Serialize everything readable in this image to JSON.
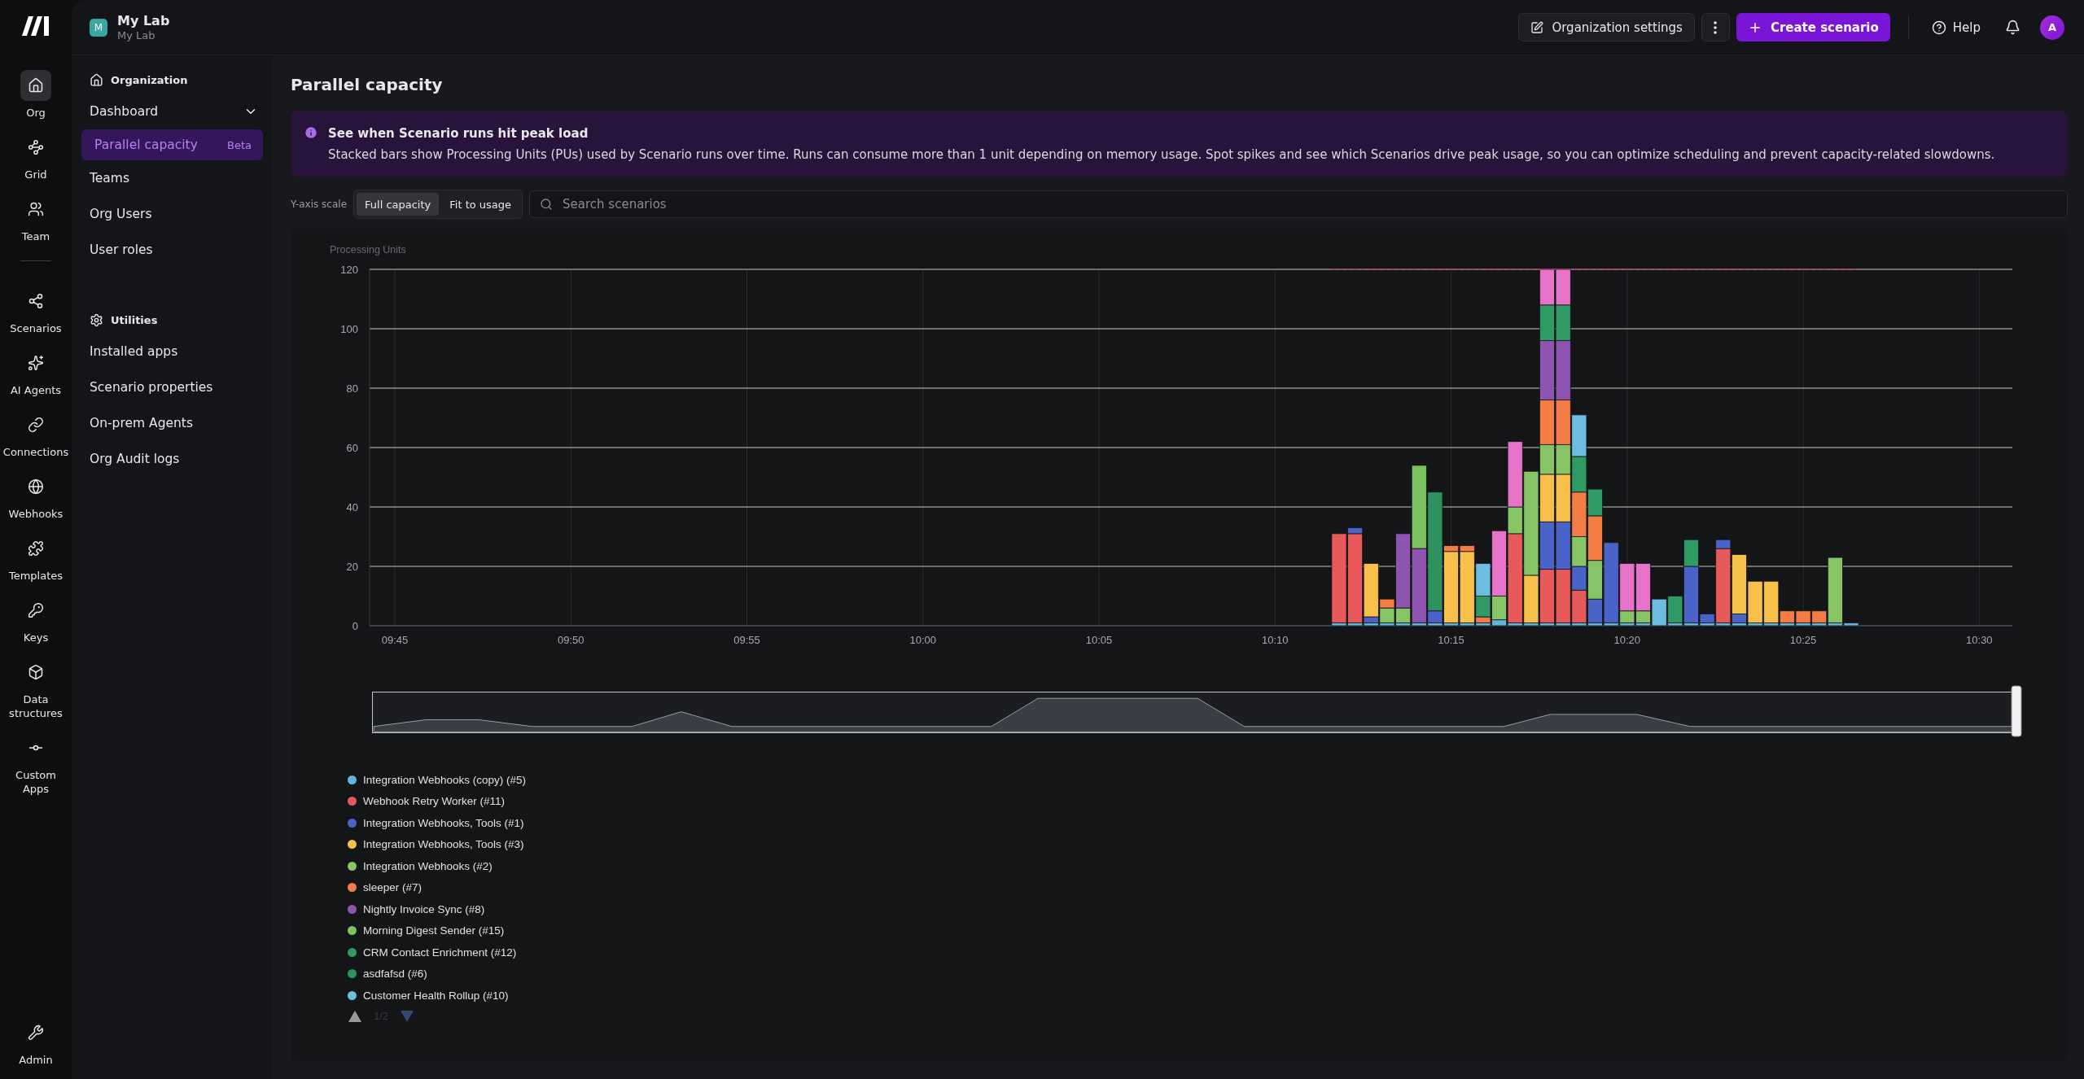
{
  "rail": {
    "top_items": [
      {
        "label": "Org",
        "selected": true
      },
      {
        "label": "Grid",
        "selected": false
      },
      {
        "label": "Team",
        "selected": false
      }
    ],
    "main_items": [
      {
        "label": "Scenarios",
        "selected": false
      },
      {
        "label": "AI Agents",
        "selected": false
      },
      {
        "label": "Connections",
        "selected": false
      },
      {
        "label": "Webhooks",
        "selected": false
      },
      {
        "label": "Templates",
        "selected": false
      },
      {
        "label": "Keys",
        "selected": false
      },
      {
        "label": "Data structures",
        "selected": false
      },
      {
        "label": "Custom Apps",
        "selected": false
      }
    ],
    "bottom_items": [
      {
        "label": "Admin",
        "selected": false
      }
    ]
  },
  "workspace": {
    "avatar": "M",
    "name": "My Lab",
    "subtitle": "My Lab"
  },
  "header": {
    "settings_button": "Organization settings",
    "create_button": "Create scenario",
    "help": "Help",
    "user_avatar": "A"
  },
  "sidebar": {
    "sections": [
      {
        "title": "Organization",
        "items": [
          {
            "label": "Dashboard",
            "selected": false,
            "expanded": true,
            "children": [
              {
                "label": "Parallel capacity",
                "badge": "Beta",
                "selected": true
              }
            ]
          },
          {
            "label": "Teams",
            "selected": false
          },
          {
            "label": "Org Users",
            "selected": false
          },
          {
            "label": "User roles",
            "selected": false
          }
        ]
      },
      {
        "title": "Utilities",
        "items": [
          {
            "label": "Installed apps",
            "selected": false
          },
          {
            "label": "Scenario properties",
            "selected": false
          },
          {
            "label": "On-prem Agents",
            "selected": false
          },
          {
            "label": "Org Audit logs",
            "selected": false
          }
        ]
      }
    ]
  },
  "page_title": "Parallel capacity",
  "banner": {
    "title": "See when Scenario runs hit peak load",
    "text": "Stacked bars show Processing Units (PUs) used by Scenario runs over time. Runs can consume more than 1 unit depending on memory usage. Spot spikes and see which Scenarios drive peak usage, so you can optimize scheduling and prevent capacity-related slowdowns."
  },
  "controls": {
    "scale_label": "Y-axis scale",
    "scale_options": [
      {
        "label": "Full capacity",
        "selected": true
      },
      {
        "label": "Fit to usage",
        "selected": false
      }
    ],
    "search": {
      "placeholder": "Search scenarios"
    }
  },
  "chart": {
    "chart_data": {
      "type": "bar",
      "stacked": true,
      "grid": true,
      "ylabel": "Processing Units",
      "ylim": [
        0,
        120
      ],
      "yticks": [
        0,
        20,
        40,
        60,
        80,
        100,
        120
      ],
      "categories": [
        "09:45",
        null,
        null,
        null,
        null,
        null,
        null,
        null,
        null,
        null,
        null,
        "09:50",
        null,
        null,
        null,
        null,
        null,
        null,
        null,
        null,
        null,
        null,
        "09:55",
        null,
        null,
        null,
        null,
        null,
        null,
        null,
        null,
        null,
        null,
        "10:00",
        null,
        null,
        null,
        null,
        null,
        null,
        null,
        null,
        null,
        null,
        "10:05",
        null,
        null,
        null,
        null,
        null,
        null,
        null,
        null,
        null,
        null,
        "10:10",
        null,
        null,
        null,
        null,
        null,
        null,
        null,
        null,
        null,
        null,
        "10:15",
        null,
        null,
        null,
        null,
        null,
        null,
        null,
        null,
        null,
        null,
        "10:20",
        null,
        null,
        null,
        null,
        null,
        null,
        null,
        null,
        null,
        null,
        "10:25",
        null,
        null,
        null,
        null,
        null,
        null,
        null,
        null,
        null,
        null,
        "10:30"
      ],
      "series": [
        {
          "name": "Integration Webhooks (copy) (#5)",
          "color": "#62b5db",
          "values": [
            0,
            0,
            0,
            0,
            0,
            0,
            0,
            0,
            0,
            0,
            0,
            0,
            0,
            0,
            0,
            0,
            0,
            0,
            0,
            0,
            0,
            0,
            0,
            0,
            0,
            0,
            0,
            0,
            0,
            0,
            0,
            0,
            0,
            0,
            0,
            0,
            0,
            0,
            0,
            0,
            0,
            0,
            0,
            0,
            0,
            0,
            0,
            0,
            0,
            0,
            0,
            0,
            0,
            0,
            0,
            0,
            0,
            0,
            0,
            1,
            1,
            1,
            1,
            1,
            1,
            1,
            1,
            1,
            1,
            2,
            1,
            1,
            1,
            1,
            1,
            1,
            1,
            1,
            1,
            0,
            1,
            1,
            1,
            1,
            1,
            1,
            1,
            1,
            1,
            1,
            1,
            1,
            0,
            0,
            0,
            0,
            0,
            0,
            0,
            0
          ]
        },
        {
          "name": "Webhook Retry Worker (#11)",
          "color": "#e85a5a",
          "values": [
            0,
            0,
            0,
            0,
            0,
            0,
            0,
            0,
            0,
            0,
            0,
            0,
            0,
            0,
            0,
            0,
            0,
            0,
            0,
            0,
            0,
            0,
            0,
            0,
            0,
            0,
            0,
            0,
            0,
            0,
            0,
            0,
            0,
            0,
            0,
            0,
            0,
            0,
            0,
            0,
            0,
            0,
            0,
            0,
            0,
            0,
            0,
            0,
            0,
            0,
            0,
            0,
            0,
            0,
            0,
            0,
            0,
            0,
            0,
            30,
            30,
            0,
            0,
            0,
            0,
            0,
            0,
            0,
            0,
            0,
            30,
            0,
            18,
            18,
            11,
            0,
            0,
            0,
            0,
            0,
            0,
            0,
            0,
            25,
            0,
            0,
            0,
            0,
            0,
            0,
            0,
            0,
            0,
            0,
            0,
            0,
            0,
            0,
            0,
            0
          ]
        },
        {
          "name": "Integration Webhooks, Tools (#1)",
          "color": "#4a63c9",
          "values": [
            0,
            0,
            0,
            0,
            0,
            0,
            0,
            0,
            0,
            0,
            0,
            0,
            0,
            0,
            0,
            0,
            0,
            0,
            0,
            0,
            0,
            0,
            0,
            0,
            0,
            0,
            0,
            0,
            0,
            0,
            0,
            0,
            0,
            0,
            0,
            0,
            0,
            0,
            0,
            0,
            0,
            0,
            0,
            0,
            0,
            0,
            0,
            0,
            0,
            0,
            0,
            0,
            0,
            0,
            0,
            0,
            0,
            0,
            0,
            0,
            2,
            2,
            0,
            0,
            0,
            4,
            0,
            0,
            0,
            0,
            0,
            0,
            16,
            16,
            8,
            8,
            27,
            0,
            0,
            0,
            0,
            19,
            3,
            3,
            3,
            0,
            0,
            0,
            0,
            0,
            0,
            0,
            0,
            0,
            0,
            0,
            0,
            0,
            0,
            0
          ]
        },
        {
          "name": "Integration Webhooks, Tools (#3)",
          "color": "#f7c04a",
          "values": [
            0,
            0,
            0,
            0,
            0,
            0,
            0,
            0,
            0,
            0,
            0,
            0,
            0,
            0,
            0,
            0,
            0,
            0,
            0,
            0,
            0,
            0,
            0,
            0,
            0,
            0,
            0,
            0,
            0,
            0,
            0,
            0,
            0,
            0,
            0,
            0,
            0,
            0,
            0,
            0,
            0,
            0,
            0,
            0,
            0,
            0,
            0,
            0,
            0,
            0,
            0,
            0,
            0,
            0,
            0,
            0,
            0,
            0,
            0,
            0,
            0,
            18,
            0,
            0,
            0,
            0,
            24,
            24,
            0,
            0,
            0,
            16,
            16,
            16,
            0,
            0,
            0,
            0,
            0,
            0,
            0,
            0,
            0,
            0,
            20,
            14,
            14,
            0,
            0,
            0,
            0,
            0,
            0,
            0,
            0,
            0,
            0,
            0,
            0,
            0
          ]
        },
        {
          "name": "Integration Webhooks (#2)",
          "color": "#86c466",
          "values": [
            0,
            0,
            0,
            0,
            0,
            0,
            0,
            0,
            0,
            0,
            0,
            0,
            0,
            0,
            0,
            0,
            0,
            0,
            0,
            0,
            0,
            0,
            0,
            0,
            0,
            0,
            0,
            0,
            0,
            0,
            0,
            0,
            0,
            0,
            0,
            0,
            0,
            0,
            0,
            0,
            0,
            0,
            0,
            0,
            0,
            0,
            0,
            0,
            0,
            0,
            0,
            0,
            0,
            0,
            0,
            0,
            0,
            0,
            0,
            0,
            0,
            0,
            5,
            5,
            0,
            0,
            0,
            0,
            0,
            8,
            9,
            35,
            10,
            10,
            10,
            13,
            0,
            4,
            4,
            0,
            0,
            0,
            0,
            0,
            0,
            0,
            0,
            0,
            0,
            0,
            22,
            0,
            0,
            0,
            0,
            0,
            0,
            0,
            0,
            0
          ]
        },
        {
          "name": "sleeper (#7)",
          "color": "#f47c45",
          "values": [
            0,
            0,
            0,
            0,
            0,
            0,
            0,
            0,
            0,
            0,
            0,
            0,
            0,
            0,
            0,
            0,
            0,
            0,
            0,
            0,
            0,
            0,
            0,
            0,
            0,
            0,
            0,
            0,
            0,
            0,
            0,
            0,
            0,
            0,
            0,
            0,
            0,
            0,
            0,
            0,
            0,
            0,
            0,
            0,
            0,
            0,
            0,
            0,
            0,
            0,
            0,
            0,
            0,
            0,
            0,
            0,
            0,
            0,
            0,
            0,
            0,
            0,
            3,
            0,
            0,
            0,
            2,
            2,
            2,
            0,
            0,
            0,
            15,
            15,
            15,
            15,
            0,
            0,
            0,
            0,
            0,
            0,
            0,
            0,
            0,
            0,
            0,
            4,
            4,
            4,
            0,
            0,
            0,
            0,
            0,
            0,
            0,
            0,
            0,
            0
          ]
        },
        {
          "name": "Nightly Invoice Sync (#8)",
          "color": "#8e55b0",
          "values": [
            0,
            0,
            0,
            0,
            0,
            0,
            0,
            0,
            0,
            0,
            0,
            0,
            0,
            0,
            0,
            0,
            0,
            0,
            0,
            0,
            0,
            0,
            0,
            0,
            0,
            0,
            0,
            0,
            0,
            0,
            0,
            0,
            0,
            0,
            0,
            0,
            0,
            0,
            0,
            0,
            0,
            0,
            0,
            0,
            0,
            0,
            0,
            0,
            0,
            0,
            0,
            0,
            0,
            0,
            0,
            0,
            0,
            0,
            0,
            0,
            0,
            0,
            0,
            25,
            25,
            0,
            0,
            0,
            0,
            0,
            0,
            0,
            20,
            20,
            0,
            0,
            0,
            0,
            0,
            0,
            0,
            0,
            0,
            0,
            0,
            0,
            0,
            0,
            0,
            0,
            0,
            0,
            0,
            0,
            0,
            0,
            0,
            0,
            0,
            0
          ]
        },
        {
          "name": "Morning Digest Sender (#15)",
          "color": "#7cc260",
          "values": [
            0,
            0,
            0,
            0,
            0,
            0,
            0,
            0,
            0,
            0,
            0,
            0,
            0,
            0,
            0,
            0,
            0,
            0,
            0,
            0,
            0,
            0,
            0,
            0,
            0,
            0,
            0,
            0,
            0,
            0,
            0,
            0,
            0,
            0,
            0,
            0,
            0,
            0,
            0,
            0,
            0,
            0,
            0,
            0,
            0,
            0,
            0,
            0,
            0,
            0,
            0,
            0,
            0,
            0,
            0,
            0,
            0,
            0,
            0,
            0,
            0,
            0,
            0,
            0,
            28,
            0,
            0,
            0,
            0,
            0,
            0,
            0,
            0,
            0,
            0,
            0,
            0,
            0,
            0,
            0,
            0,
            0,
            0,
            0,
            0,
            0,
            0,
            0,
            0,
            0,
            0,
            0,
            0,
            0,
            0,
            0,
            0,
            0,
            0,
            0
          ]
        },
        {
          "name": "CRM Contact Enrichment (#12)",
          "color": "#2f9a64",
          "values": [
            0,
            0,
            0,
            0,
            0,
            0,
            0,
            0,
            0,
            0,
            0,
            0,
            0,
            0,
            0,
            0,
            0,
            0,
            0,
            0,
            0,
            0,
            0,
            0,
            0,
            0,
            0,
            0,
            0,
            0,
            0,
            0,
            0,
            0,
            0,
            0,
            0,
            0,
            0,
            0,
            0,
            0,
            0,
            0,
            0,
            0,
            0,
            0,
            0,
            0,
            0,
            0,
            0,
            0,
            0,
            0,
            0,
            0,
            0,
            0,
            0,
            0,
            0,
            0,
            0,
            0,
            0,
            0,
            7,
            0,
            0,
            0,
            12,
            12,
            12,
            9,
            0,
            0,
            0,
            0,
            9,
            9,
            0,
            0,
            0,
            0,
            0,
            0,
            0,
            0,
            0,
            0,
            0,
            0,
            0,
            0,
            0,
            0,
            0,
            0
          ]
        },
        {
          "name": "asdfafsd (#6)",
          "color": "#2e9260",
          "values": [
            0,
            0,
            0,
            0,
            0,
            0,
            0,
            0,
            0,
            0,
            0,
            0,
            0,
            0,
            0,
            0,
            0,
            0,
            0,
            0,
            0,
            0,
            0,
            0,
            0,
            0,
            0,
            0,
            0,
            0,
            0,
            0,
            0,
            0,
            0,
            0,
            0,
            0,
            0,
            0,
            0,
            0,
            0,
            0,
            0,
            0,
            0,
            0,
            0,
            0,
            0,
            0,
            0,
            0,
            0,
            0,
            0,
            0,
            0,
            0,
            0,
            0,
            0,
            0,
            0,
            40,
            0,
            0,
            0,
            0,
            0,
            0,
            0,
            0,
            0,
            0,
            0,
            0,
            0,
            0,
            0,
            0,
            0,
            0,
            0,
            0,
            0,
            0,
            0,
            0,
            0,
            0,
            0,
            0,
            0,
            0,
            0,
            0,
            0,
            0
          ]
        },
        {
          "name": "Customer Health Rollup (#10)",
          "color": "#6cbde0",
          "values": [
            0,
            0,
            0,
            0,
            0,
            0,
            0,
            0,
            0,
            0,
            0,
            0,
            0,
            0,
            0,
            0,
            0,
            0,
            0,
            0,
            0,
            0,
            0,
            0,
            0,
            0,
            0,
            0,
            0,
            0,
            0,
            0,
            0,
            0,
            0,
            0,
            0,
            0,
            0,
            0,
            0,
            0,
            0,
            0,
            0,
            0,
            0,
            0,
            0,
            0,
            0,
            0,
            0,
            0,
            0,
            0,
            0,
            0,
            0,
            0,
            0,
            0,
            0,
            0,
            0,
            0,
            0,
            0,
            11,
            0,
            0,
            0,
            0,
            0,
            14,
            0,
            0,
            0,
            0,
            9,
            0,
            0,
            0,
            0,
            0,
            0,
            0,
            0,
            0,
            0,
            0,
            0,
            0,
            0,
            0,
            0,
            0,
            0,
            0,
            0
          ]
        },
        {
          "color": "#e673c8",
          "values": [
            0,
            0,
            0,
            0,
            0,
            0,
            0,
            0,
            0,
            0,
            0,
            0,
            0,
            0,
            0,
            0,
            0,
            0,
            0,
            0,
            0,
            0,
            0,
            0,
            0,
            0,
            0,
            0,
            0,
            0,
            0,
            0,
            0,
            0,
            0,
            0,
            0,
            0,
            0,
            0,
            0,
            0,
            0,
            0,
            0,
            0,
            0,
            0,
            0,
            0,
            0,
            0,
            0,
            0,
            0,
            0,
            0,
            0,
            0,
            0,
            0,
            0,
            0,
            0,
            0,
            0,
            0,
            0,
            0,
            22,
            22,
            0,
            12,
            12,
            0,
            0,
            0,
            16,
            16,
            0,
            0,
            0,
            0,
            0,
            0,
            0,
            0,
            0,
            0,
            0,
            0,
            0,
            0,
            0,
            0,
            0,
            0,
            0,
            0,
            0
          ]
        }
      ],
      "ref_lines": [
        {
          "axis": "y",
          "value": 120
        }
      ]
    }
  },
  "legend": {
    "pager": {
      "page": "1/2",
      "prev_enabled": false,
      "next_enabled": true
    }
  }
}
